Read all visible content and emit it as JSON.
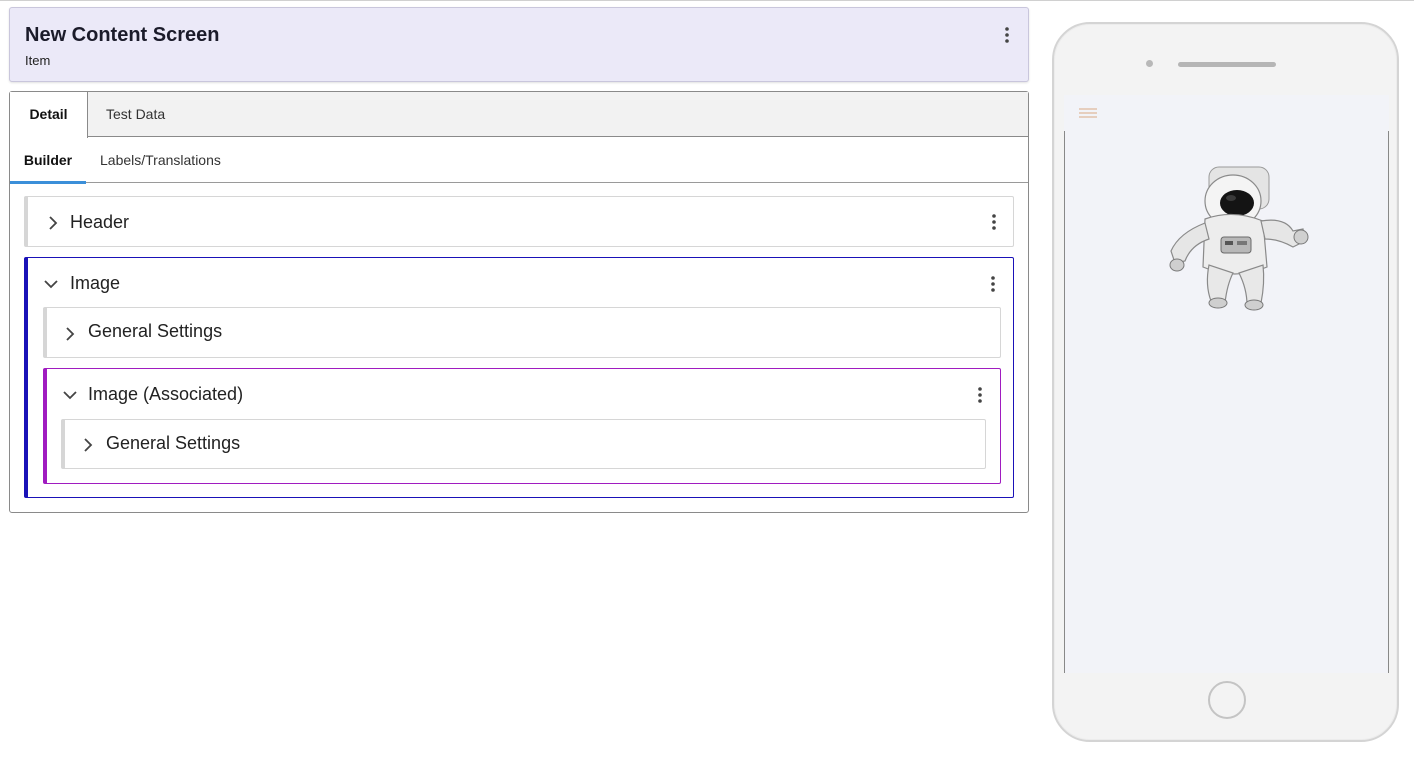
{
  "header": {
    "title": "New Content Screen",
    "subtitle": "Item",
    "menu_icon": "more-vertical-icon"
  },
  "tabs": [
    {
      "label": "Detail",
      "active": true
    },
    {
      "label": "Test Data",
      "active": false
    }
  ],
  "subtabs": [
    {
      "label": "Builder",
      "active": true
    },
    {
      "label": "Labels/Translations",
      "active": false
    }
  ],
  "sections": {
    "header": {
      "label": "Header",
      "expanded": false
    },
    "image": {
      "label": "Image",
      "expanded": true,
      "border_color": "#1a12b8",
      "general_settings": {
        "label": "General Settings",
        "expanded": false
      },
      "associated": {
        "label": "Image (Associated)",
        "expanded": true,
        "border_color": "#a01cc0",
        "general_settings": {
          "label": "General Settings",
          "expanded": false
        }
      }
    }
  },
  "preview": {
    "device": "phone",
    "menu_icon": "hamburger-menu-icon",
    "image": "astronaut-image"
  },
  "colors": {
    "title_bg": "#ebe9f8",
    "active_tab_underline": "#3b8fd9"
  }
}
